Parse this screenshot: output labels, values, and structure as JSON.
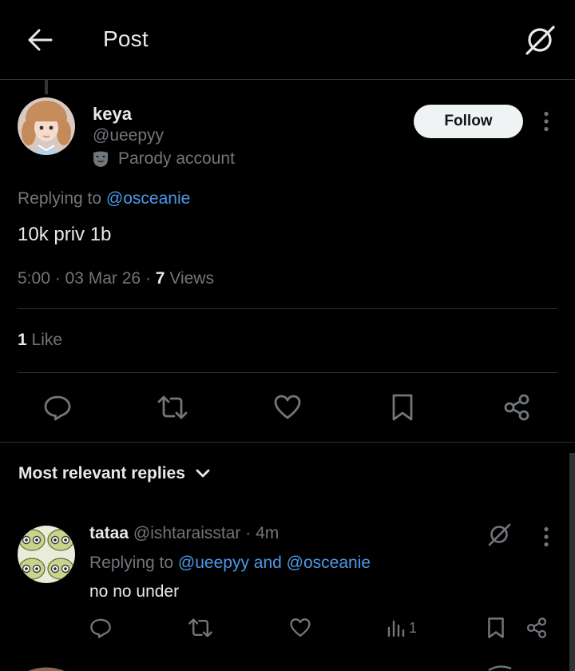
{
  "header": {
    "title": "Post",
    "back_icon": "arrow-left-icon",
    "grok_icon": "grok-icon"
  },
  "post": {
    "author_name": "keya",
    "author_handle": "@ueepyy",
    "parody_label": "Parody account",
    "follow_label": "Follow",
    "replying_prefix": "Replying to",
    "replying_to": "@osceanie",
    "text": "10k priv 1b",
    "time": "5:00",
    "date": "03 Mar 26",
    "views_count": "7",
    "views_label": "Views",
    "likes_count": "1",
    "likes_label": "Like"
  },
  "actions": [
    "reply-icon",
    "repost-icon",
    "like-icon",
    "bookmark-icon",
    "share-icon"
  ],
  "replies_section": {
    "sort_label": "Most relevant replies"
  },
  "reply": {
    "author_name": "tataa",
    "author_handle": "@ishtaraisstar",
    "time": "4m",
    "replying_prefix": "Replying to",
    "replying_to": "@ueepyy and @osceanie",
    "text": "no no under",
    "views_count": "1"
  },
  "colors": {
    "background": "#000000",
    "text_primary": "#e7e9ea",
    "text_secondary": "#71767b",
    "accent": "#4a99e9",
    "divider": "#2f3336",
    "follow_bg": "#eff3f4"
  }
}
